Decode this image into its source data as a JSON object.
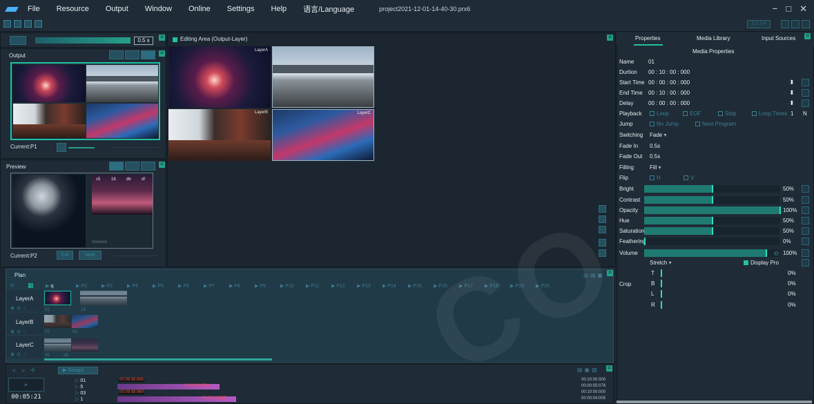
{
  "menubar": {
    "items": [
      "File",
      "Resource",
      "Output",
      "Window",
      "Online",
      "Settings",
      "Help",
      "语言/Language"
    ],
    "project": "project2021-12-01-14-40-30.prx6",
    "controls": [
      "−",
      "□",
      "✕"
    ]
  },
  "toolbar": {
    "pill_label": "1 2 3 4"
  },
  "top_left": {
    "fade_time": "0.5 s"
  },
  "output": {
    "title": "Output",
    "current": "Current:P1"
  },
  "preview": {
    "title": "Preview",
    "current": "Current:P2",
    "cut_label": "Cut",
    "next_label": "Next",
    "screen_label": "Screen1",
    "tile_labels": [
      "c5",
      "18",
      "db",
      "df"
    ]
  },
  "editing": {
    "title": "Editing Area (Output-Layer)",
    "layer_a": "LayerA",
    "layer_b": "LayerB",
    "layer_c": "LayerC"
  },
  "properties": {
    "tabs": [
      "Properties",
      "Media Library",
      "Input Sources"
    ],
    "section_title": "Media Properties",
    "name_label": "Name",
    "name_value": "01",
    "duration_label": "Durtion",
    "duration_value": "00 : 10 : 00 : 000",
    "start_label": "Start Time",
    "start_value": "00 : 00 : 00 : 000",
    "end_label": "End Time",
    "end_value": "00 : 10 : 00 : 000",
    "delay_label": "Delay",
    "delay_value": "00 : 00 : 00 : 000",
    "playback_label": "Playback",
    "playback_options": [
      "Loop",
      "EOF",
      "Stop",
      "Loop Times"
    ],
    "loop_times_value": "1",
    "loop_times_unit": "N",
    "jump_label": "Jump",
    "jump_options": [
      "No Jump",
      "Next Program"
    ],
    "switching_label": "Switching",
    "switching_value": "Fade",
    "fade_in_label": "Fade In",
    "fade_in_value": "0.5s",
    "fade_out_label": "Fade Out",
    "fade_out_value": "0.5s",
    "filling_label": "Filling",
    "filling_value": "Fill",
    "flip_label": "Flip",
    "flip_h": "H",
    "flip_v": "V",
    "sliders": [
      {
        "label": "Bright",
        "value_text": "50%",
        "value": 0.5
      },
      {
        "label": "Contrast",
        "value_text": "50%",
        "value": 0.5
      },
      {
        "label": "Opacity",
        "value_text": "100%",
        "value": 1.0
      },
      {
        "label": "Hue",
        "value_text": "50%",
        "value": 0.5
      },
      {
        "label": "Saturation",
        "value_text": "50%",
        "value": 0.5
      },
      {
        "label": "Feathering",
        "value_text": "0%",
        "value": 0.0
      },
      {
        "label": "Volume",
        "value_text": "100%",
        "value": 1.0
      }
    ],
    "stretch_value": "Stretch",
    "display_pro_label": "Display Pro",
    "crop_label": "Crop",
    "crop": [
      {
        "label": "T",
        "value_text": "0%"
      },
      {
        "label": "B",
        "value_text": "0%"
      },
      {
        "label": "L",
        "value_text": "0%"
      },
      {
        "label": "R",
        "value_text": "0%"
      }
    ]
  },
  "plan": {
    "title": "Plan",
    "first_mark": "q",
    "marks": [
      "P2",
      "P3",
      "P4",
      "P5",
      "P6",
      "P7",
      "P8",
      "P9",
      "P10",
      "P11",
      "P12",
      "P13",
      "P14",
      "P15",
      "P16",
      "P17",
      "P18",
      "P19",
      "P20"
    ],
    "layers": [
      "LayerA",
      "LayerB",
      "LayerC"
    ],
    "clip_numbers": [
      "01",
      "18",
      "02",
      "03",
      "05",
      "06"
    ]
  },
  "timeline": {
    "group_label": "Group1",
    "clock": "00:05:21",
    "tracks": [
      {
        "name": "01",
        "time": "00:09:58:895",
        "duration": "00:10:00:000"
      },
      {
        "name": "5",
        "time": "00:00:03:596",
        "duration": "00:00:05:076"
      },
      {
        "name": "03",
        "time": "00:09:58:960",
        "duration": "00:10:00:000"
      },
      {
        "name": "1",
        "time": "00:00:02:965",
        "duration": "00:00:04:005"
      }
    ]
  },
  "colors": {
    "accent": "#21c1a4",
    "panel": "#1f2b36",
    "background": "#1b2630",
    "slider_fill": "#1f7b72"
  },
  "watermark": "CO"
}
